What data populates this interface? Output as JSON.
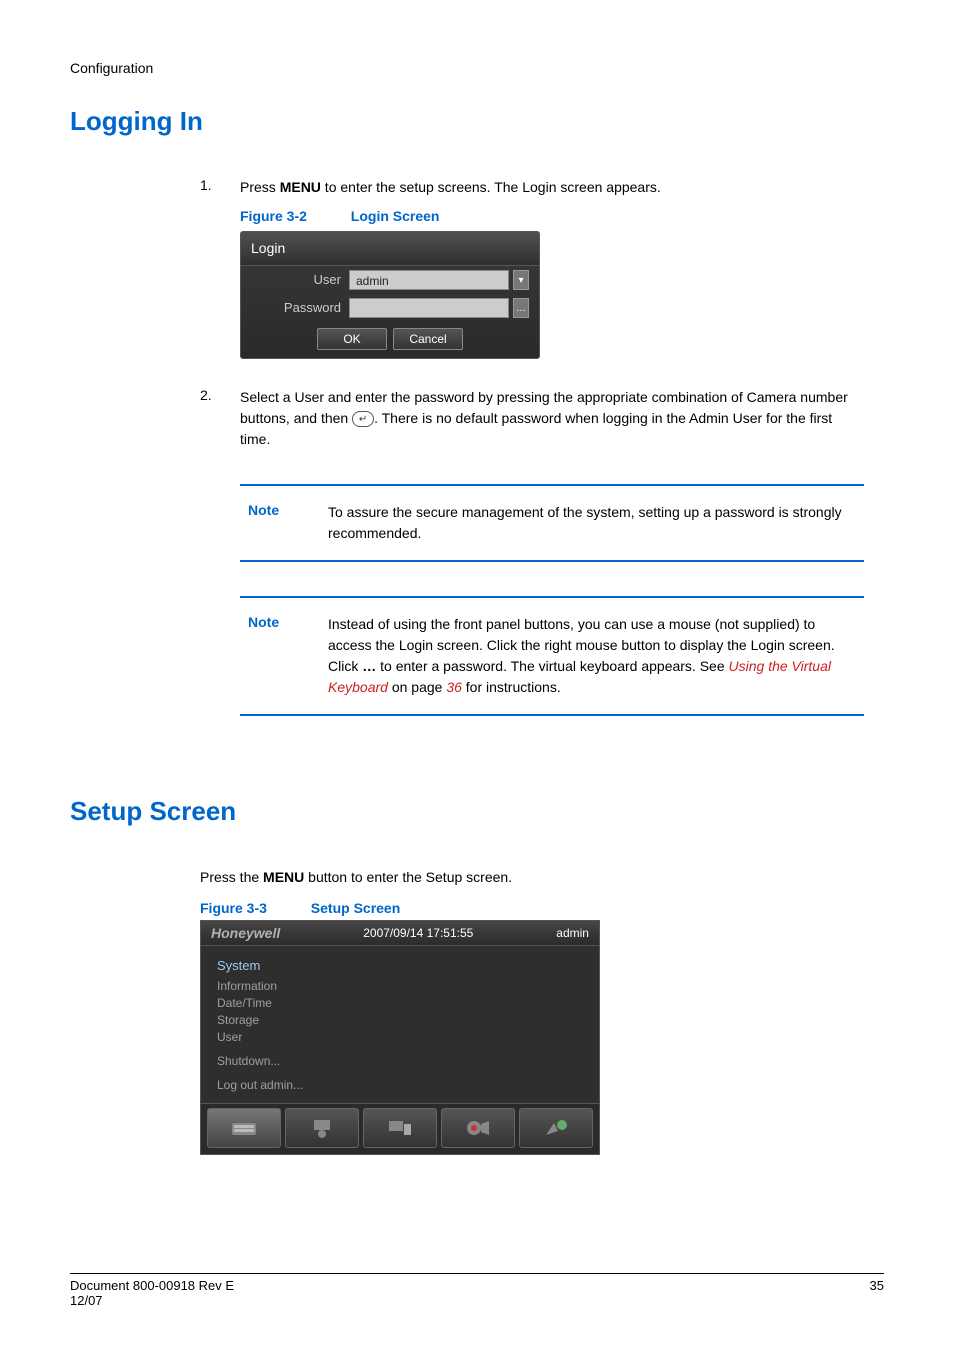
{
  "header": {
    "label": "Configuration"
  },
  "sections": {
    "logging_in": {
      "title": "Logging In"
    },
    "setup_screen": {
      "title": "Setup Screen"
    }
  },
  "steps": {
    "s1_num": "1.",
    "s1_a": "Press ",
    "s1_b": "MENU",
    "s1_c": " to enter the setup screens. The Login screen appears.",
    "s2_num": "2.",
    "s2_a": "Select a User and enter the password by pressing the appropriate combination of Camera number buttons, and then ",
    "s2_icon": "↵",
    "s2_b": ". There is no default password when logging in the Admin User for the first time."
  },
  "fig32": {
    "num": "Figure 3-2",
    "title": "Login Screen",
    "dialog": {
      "title": "Login",
      "user_label": "User",
      "user_value": "admin",
      "password_label": "Password",
      "password_value": "",
      "kbd_btn": "…",
      "ok": "OK",
      "cancel": "Cancel"
    }
  },
  "note1": {
    "label": "Note",
    "text": "To assure the secure management of the system, setting up a password is strongly recommended."
  },
  "note2": {
    "label": "Note",
    "a": "Instead of using the front panel buttons, you can use a mouse (not supplied) to access the Login screen. Click the right mouse button to display the Login screen. Click ",
    "dots": "…",
    "b": " to enter a password. The virtual keyboard appears. See ",
    "link": "Using the Virtual Keyboard",
    "c": " on page ",
    "page": "36",
    "d": " for instructions."
  },
  "setup_intro_a": "Press the ",
  "setup_intro_b": "MENU",
  "setup_intro_c": " button to enter the Setup screen.",
  "fig33": {
    "num": "Figure 3-3",
    "title": "Setup Screen",
    "dialog": {
      "logo": "Honeywell",
      "datetime": "2007/09/14  17:51:55",
      "user": "admin",
      "menu_head": "System",
      "items": [
        "Information",
        "Date/Time",
        "Storage",
        "User",
        "Shutdown...",
        "Log out admin..."
      ]
    }
  },
  "footer": {
    "left_a": "Document 800-00918 Rev E",
    "left_b": "12/07",
    "right": "35"
  }
}
